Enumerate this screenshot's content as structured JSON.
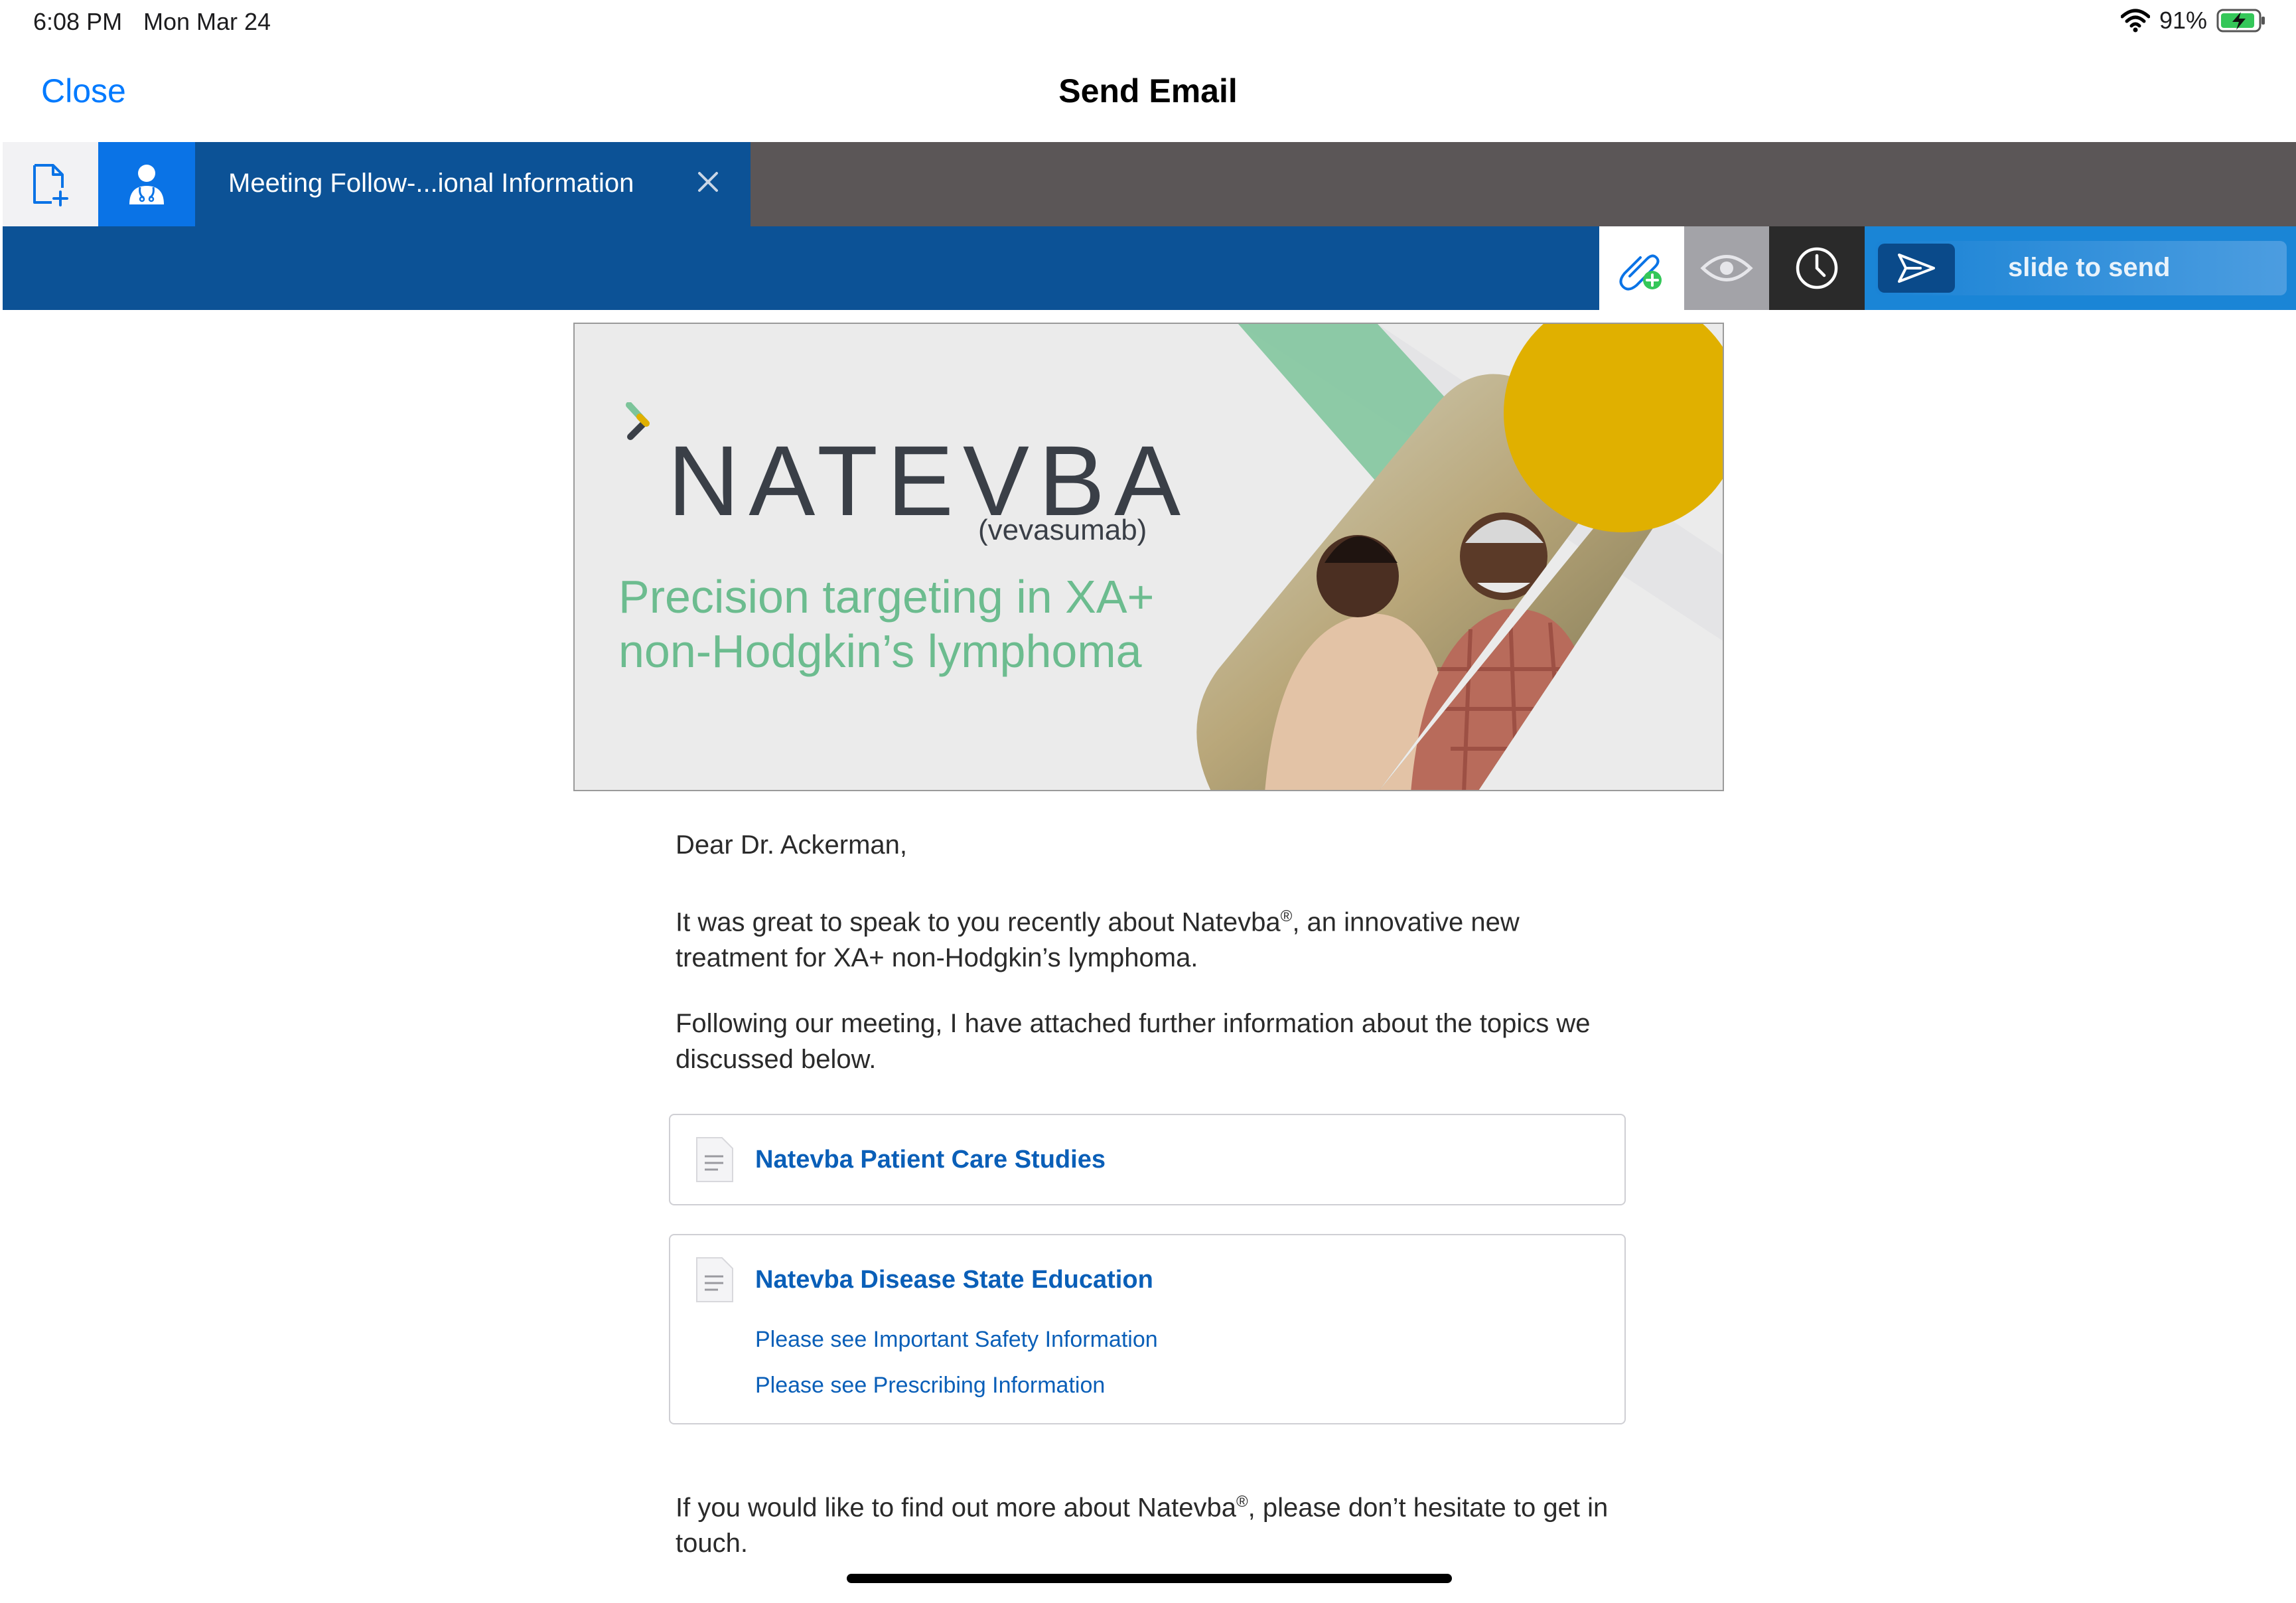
{
  "status_bar": {
    "time": "6:08 PM",
    "date": "Mon Mar 24",
    "battery": "91%"
  },
  "nav": {
    "close_label": "Close",
    "title": "Send Email"
  },
  "tabs": {
    "active_label": "Meeting Follow-...ional Information"
  },
  "toolbar": {
    "slide_label": "slide to send"
  },
  "banner": {
    "brand": "NATEVBA",
    "generic": "(vevasumab)",
    "tagline_line1": "Precision targeting in XA+",
    "tagline_line2": "non-Hodgkin’s lymphoma"
  },
  "email": {
    "greeting": "Dear Dr. Ackerman,",
    "p1_a": "It was great to speak to you recently about Natevba",
    "p1_sup": "®",
    "p1_b": ", an innovative new treatment for XA+ non-Hodgkin’s lymphoma.",
    "p2": "Following our meeting, I have attached further information about the topics we discussed below.",
    "doc1_title": "Natevba Patient Care Studies",
    "doc2_title": "Natevba Disease State Education",
    "doc2_link1": "Please see Important Safety Information",
    "doc2_link2": "Please see Prescribing Information",
    "p3_a": "If you would like to find out more about Natevba",
    "p3_sup": "®",
    "p3_b": ", please don’t hesitate to get in touch."
  },
  "colors": {
    "accent": "#007aff",
    "toolbar": "#0c5296",
    "tab_bar": "#5b5657",
    "link": "#0a5fb8",
    "tagline": "#6cbc8f",
    "gold": "#e0b000"
  }
}
